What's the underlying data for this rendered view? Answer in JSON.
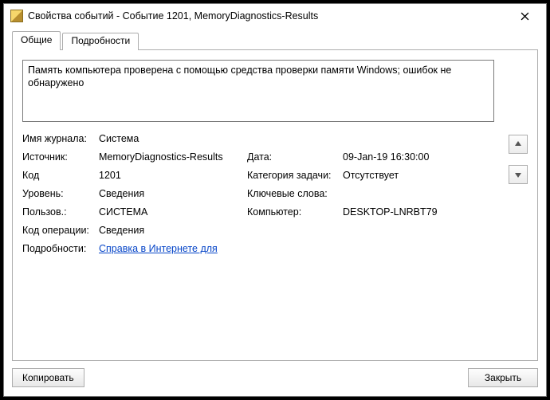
{
  "titlebar": {
    "title": "Свойства событий - Событие 1201, MemoryDiagnostics-Results"
  },
  "tabs": {
    "general": "Общие",
    "details": "Подробности"
  },
  "message": "Память компьютера проверена с помощью средства проверки памяти Windows; ошибок не обнаружено",
  "labels": {
    "log_name": "Имя журнала:",
    "source": "Источник:",
    "event_id": "Код",
    "level": "Уровень:",
    "user": "Пользов.:",
    "opcode": "Код операции:",
    "more_info": "Подробности:",
    "date": "Дата:",
    "task_category": "Категория задачи:",
    "keywords": "Ключевые слова:",
    "computer": "Компьютер:"
  },
  "values": {
    "log_name": "Система",
    "source": "MemoryDiagnostics-Results",
    "event_id": "1201",
    "level": "Сведения",
    "user": "СИСТЕМА",
    "opcode": "Сведения",
    "date": "09-Jan-19 16:30:00",
    "task_category": "Отсутствует",
    "keywords": "",
    "computer": "DESKTOP-LNRBT79",
    "help_link": "Справка в Интернете для "
  },
  "footer": {
    "copy": "Копировать",
    "close": "Закрыть"
  }
}
